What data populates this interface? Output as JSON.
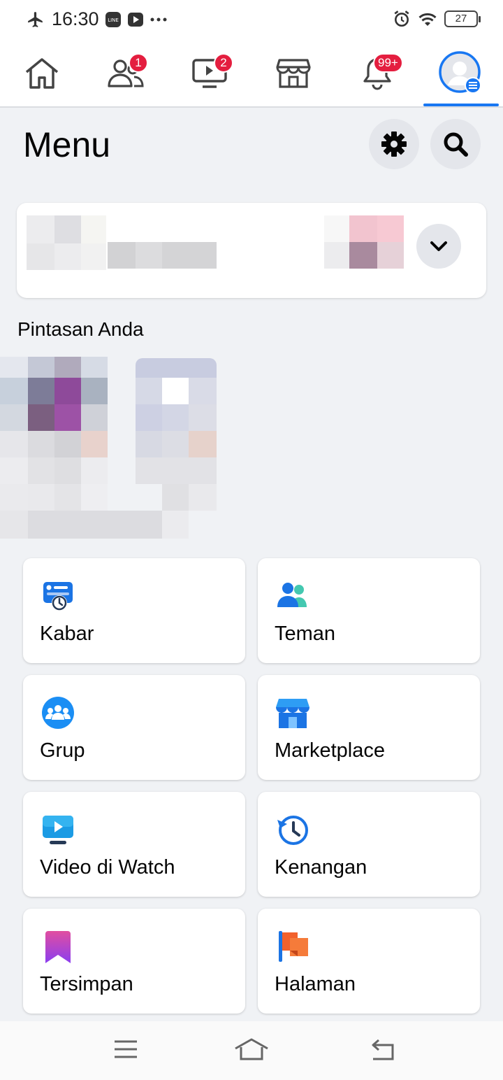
{
  "status_bar": {
    "time": "16:30",
    "battery": "27"
  },
  "top_nav": {
    "tabs": [
      {
        "name": "home-tab",
        "icon": "home-icon",
        "badge": ""
      },
      {
        "name": "friends-tab",
        "icon": "friends-icon",
        "badge": "1"
      },
      {
        "name": "watch-tab",
        "icon": "watch-icon",
        "badge": "2"
      },
      {
        "name": "marketplace-tab",
        "icon": "marketplace-icon",
        "badge": ""
      },
      {
        "name": "notifications-tab",
        "icon": "bell-icon",
        "badge": "99+"
      },
      {
        "name": "menu-tab",
        "icon": "profile-menu-icon",
        "badge": "",
        "active": true
      }
    ],
    "badges": {
      "friends": "1",
      "watch": "2",
      "notifications": "99+"
    },
    "accent_color": "#1877f2",
    "badge_color": "#e41e3f"
  },
  "header": {
    "title": "Menu"
  },
  "shortcuts": {
    "label": "Pintasan Anda"
  },
  "menu_tiles": {
    "kabar": "Kabar",
    "teman": "Teman",
    "grup": "Grup",
    "marketplace": "Marketplace",
    "video": "Video di Watch",
    "kenangan": "Kenangan",
    "tersimpan": "Tersimpan",
    "halaman": "Halaman"
  }
}
